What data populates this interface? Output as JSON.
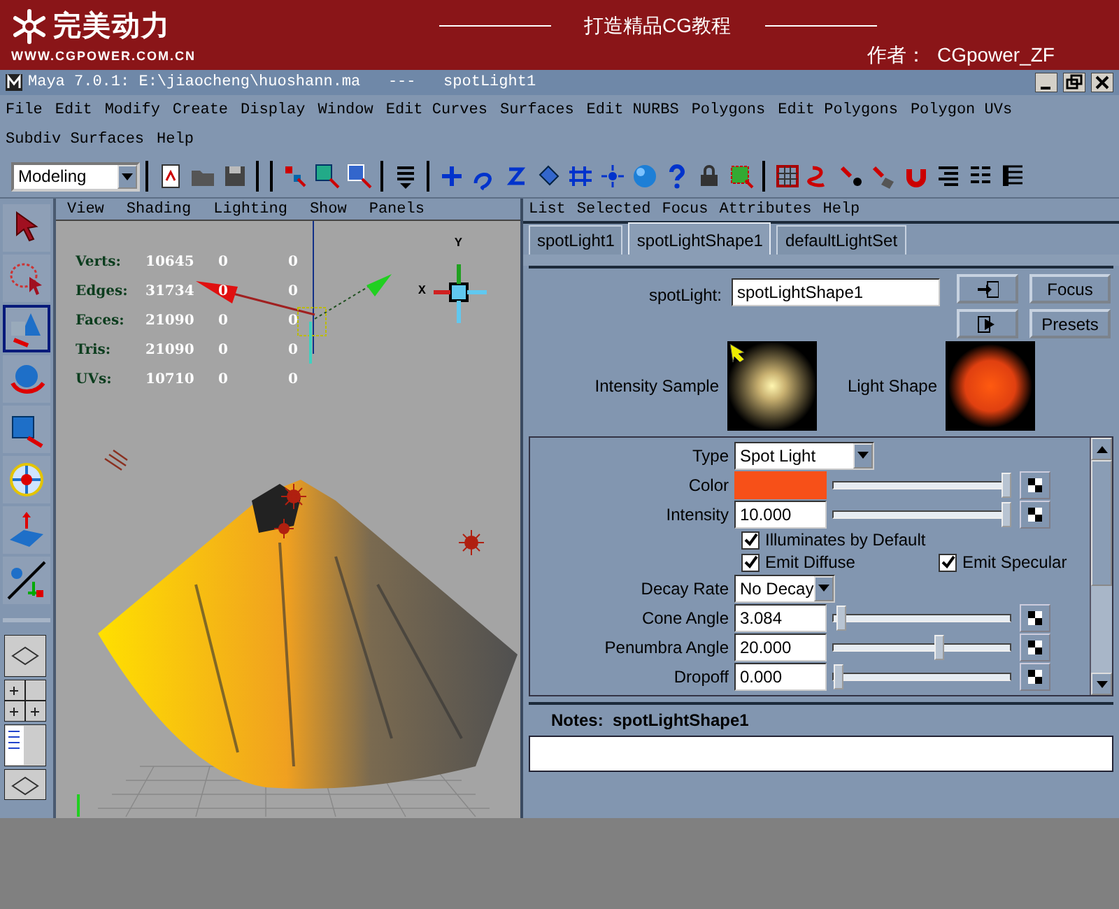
{
  "banner": {
    "logo_text": "完美动力",
    "url": "WWW.CGPOWER.COM.CN",
    "slogan": "打造精品CG教程",
    "author": "作者：  CGpower_ZF"
  },
  "window": {
    "title": "Maya 7.0.1: E:\\jiaocheng\\huoshann.ma   ---   spotLight1"
  },
  "menu_bar": [
    "File",
    "Edit",
    "Modify",
    "Create",
    "Display",
    "Window",
    "Edit Curves",
    "Surfaces",
    "Edit NURBS",
    "Polygons",
    "Edit Polygons",
    "Polygon UVs",
    "Subdiv Surfaces",
    "Help"
  ],
  "toolbar": {
    "menu_set": "Modeling"
  },
  "toolbox": [
    {
      "selected": false
    },
    {
      "selected": false
    },
    {
      "selected": true
    },
    {
      "selected": false
    },
    {
      "selected": false
    },
    {
      "selected": false
    },
    {
      "selected": false
    },
    {
      "selected": false
    }
  ],
  "viewport": {
    "menu": [
      "View",
      "Shading",
      "Lighting",
      "Show",
      "Panels"
    ],
    "stats": [
      {
        "label": "Verts:",
        "values": [
          "10645",
          "0",
          "0"
        ]
      },
      {
        "label": "Edges:",
        "values": [
          "31734",
          "0",
          "0"
        ]
      },
      {
        "label": "Faces:",
        "values": [
          "21090",
          "0",
          "0"
        ]
      },
      {
        "label": "Tris:",
        "values": [
          "21090",
          "0",
          "0"
        ]
      },
      {
        "label": "UVs:",
        "values": [
          "10710",
          "0",
          "0"
        ]
      }
    ],
    "view_axis_labels": [
      "Y",
      "X"
    ]
  },
  "attribute_editor": {
    "menu": [
      "List",
      "Selected",
      "Focus",
      "Attributes",
      "Help"
    ],
    "tabs": [
      {
        "label": "spotLight1",
        "selected": false
      },
      {
        "label": "spotLightShape1",
        "selected": true
      },
      {
        "label": "defaultLightSet",
        "selected": false
      }
    ],
    "node_label": "spotLight:",
    "node_value": "spotLightShape1",
    "buttons": [
      "Focus",
      "Presets"
    ],
    "samples": [
      {
        "label": "Intensity Sample",
        "kind": "intensity"
      },
      {
        "label": "Light Shape",
        "kind": "shape"
      }
    ],
    "attributes": [
      {
        "kind": "dropdown",
        "label": "Type",
        "value": "Spot Light"
      },
      {
        "kind": "color",
        "label": "Color",
        "color": "#f75018",
        "level": 0.97
      },
      {
        "kind": "slider",
        "label": "Intensity",
        "value": "10.000",
        "level": 0.97
      },
      {
        "kind": "checks",
        "items": [
          {
            "label": "Illuminates by Default",
            "checked": true
          }
        ]
      },
      {
        "kind": "checks",
        "items": [
          {
            "label": "Emit Diffuse",
            "checked": true
          },
          {
            "label": "Emit Specular",
            "checked": true
          }
        ]
      },
      {
        "kind": "dropdown",
        "label": "Decay Rate",
        "value": "No Decay"
      },
      {
        "kind": "slider",
        "label": "Cone Angle",
        "value": "3.084",
        "level": 0.05
      },
      {
        "kind": "slider",
        "label": "Penumbra Angle",
        "value": "20.000",
        "level": 0.59
      },
      {
        "kind": "slider",
        "label": "Dropoff",
        "value": "0.000",
        "level": 0.03
      }
    ],
    "notes_title": "Notes:  spotLightShape1"
  }
}
